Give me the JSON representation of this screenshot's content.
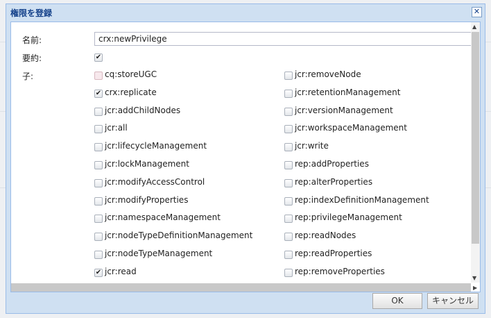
{
  "dialog": {
    "title": "権限を登録",
    "name_label": "名前:",
    "name_value": "crx:newPrivilege",
    "summary_label": "要約:",
    "summary_checked": true,
    "children_label": "子:",
    "ok": "OK",
    "cancel": "キャンセル"
  },
  "left": [
    {
      "label": "cq:storeUGC",
      "checked": false
    },
    {
      "label": "crx:replicate",
      "checked": true
    },
    {
      "label": "jcr:addChildNodes",
      "checked": false
    },
    {
      "label": "jcr:all",
      "checked": false
    },
    {
      "label": "jcr:lifecycleManagement",
      "checked": false
    },
    {
      "label": "jcr:lockManagement",
      "checked": false
    },
    {
      "label": "jcr:modifyAccessControl",
      "checked": false
    },
    {
      "label": "jcr:modifyProperties",
      "checked": false
    },
    {
      "label": "jcr:namespaceManagement",
      "checked": false
    },
    {
      "label": "jcr:nodeTypeDefinitionManagement",
      "checked": false
    },
    {
      "label": "jcr:nodeTypeManagement",
      "checked": false
    },
    {
      "label": "jcr:read",
      "checked": true
    }
  ],
  "right": [
    {
      "label": "jcr:removeNode",
      "checked": false
    },
    {
      "label": "jcr:retentionManagement",
      "checked": false
    },
    {
      "label": "jcr:versionManagement",
      "checked": false
    },
    {
      "label": "jcr:workspaceManagement",
      "checked": false
    },
    {
      "label": "jcr:write",
      "checked": false
    },
    {
      "label": "rep:addProperties",
      "checked": false
    },
    {
      "label": "rep:alterProperties",
      "checked": false
    },
    {
      "label": "rep:indexDefinitionManagement",
      "checked": false
    },
    {
      "label": "rep:privilegeManagement",
      "checked": false
    },
    {
      "label": "rep:readNodes",
      "checked": false
    },
    {
      "label": "rep:readProperties",
      "checked": false
    },
    {
      "label": "rep:removeProperties",
      "checked": false
    }
  ]
}
